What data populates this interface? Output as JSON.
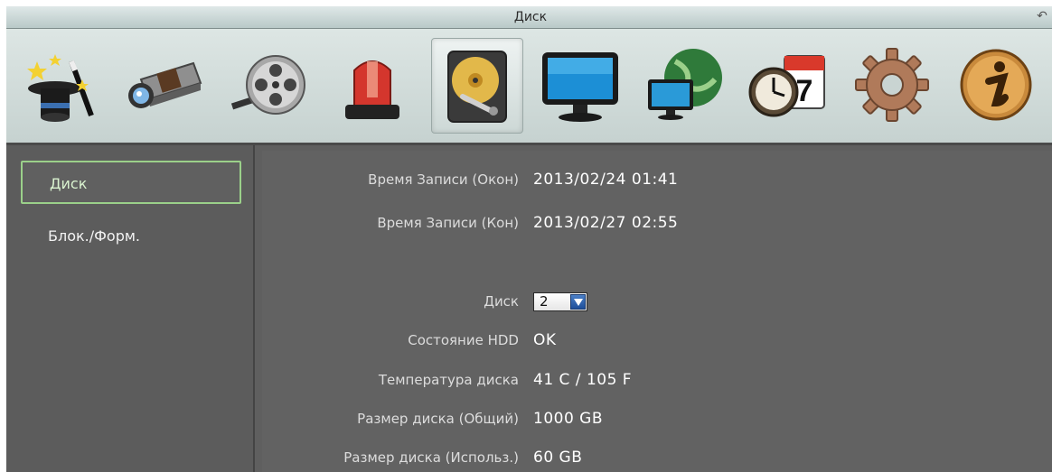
{
  "window": {
    "title": "Диск"
  },
  "toolbar": {
    "items": [
      {
        "icon": "wizard-hat-icon"
      },
      {
        "icon": "camera-icon"
      },
      {
        "icon": "film-reel-icon"
      },
      {
        "icon": "alarm-siren-icon"
      },
      {
        "icon": "hard-disk-icon",
        "active": true
      },
      {
        "icon": "monitor-icon"
      },
      {
        "icon": "network-globe-icon"
      },
      {
        "icon": "clock-calendar-icon",
        "calendar_day": "7"
      },
      {
        "icon": "gear-icon"
      },
      {
        "icon": "info-icon"
      }
    ]
  },
  "sidebar": {
    "items": [
      {
        "label": "Диск",
        "selected": true
      },
      {
        "label": "Блок./Форм."
      }
    ]
  },
  "disk_info": {
    "rec_start_label": "Время Записи (Окон)",
    "rec_start_value": "2013/02/24  01:41",
    "rec_end_label": "Время Записи (Кон)",
    "rec_end_value": "2013/02/27  02:55",
    "disk_label": "Диск",
    "disk_value": "2",
    "hdd_state_label": "Состояние HDD",
    "hdd_state_value": "OK",
    "temp_label": "Температура диска",
    "temp_value": "41 C / 105 F",
    "size_total_label": "Размер диска (Общий)",
    "size_total_value": "1000 GB",
    "size_used_label": "Размер диска (Использ.)",
    "size_used_value": "60 GB"
  },
  "colors": {
    "accent_selected": "#9bd08a",
    "panel_bg": "#626262",
    "dropdown_arrow": "#1e4e9a"
  }
}
